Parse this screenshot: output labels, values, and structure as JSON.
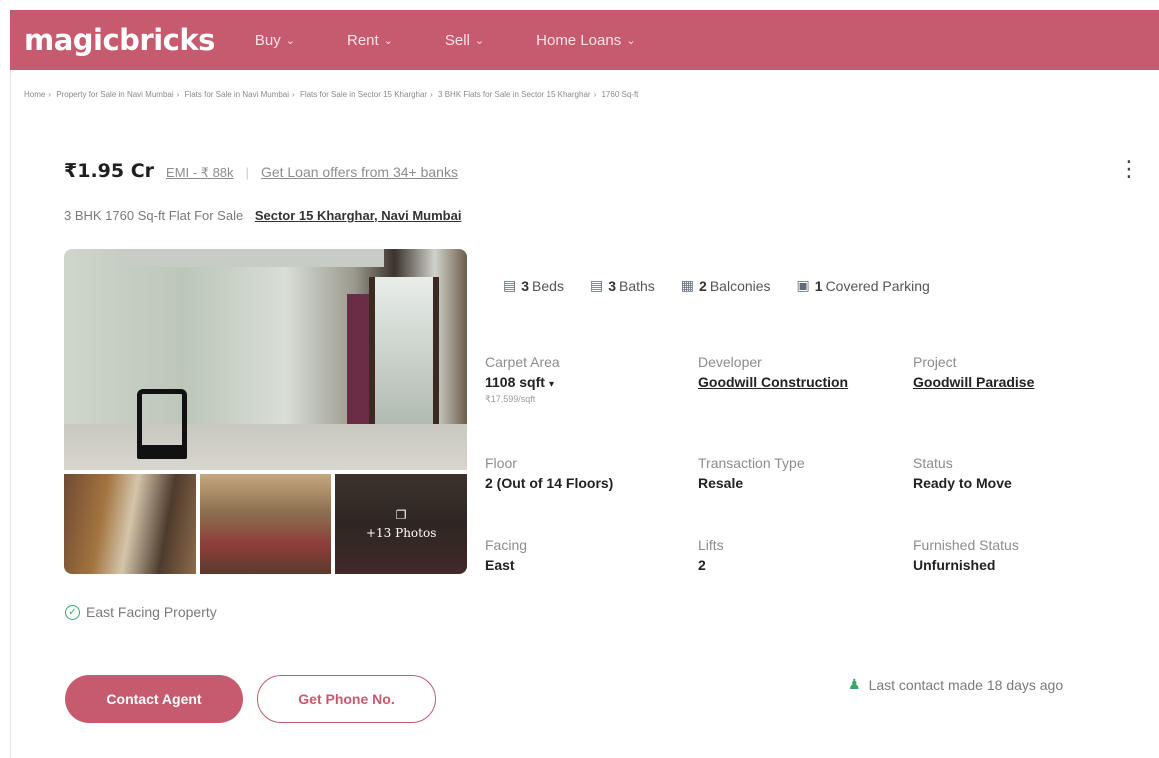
{
  "header": {
    "logo": "magicbricks",
    "nav": [
      {
        "label": "Buy"
      },
      {
        "label": "Rent"
      },
      {
        "label": "Sell"
      },
      {
        "label": "Home Loans"
      }
    ]
  },
  "breadcrumb": [
    "Home",
    "Property for Sale in Navi Mumbai",
    "Flats for Sale in Navi Mumbai",
    "Flats for Sale in Sector 15 Kharghar",
    "3 BHK Flats for Sale in Sector 15 Kharghar",
    "1760 Sq-ft"
  ],
  "listing": {
    "price": "₹1.95 Cr",
    "emi": "EMI - ₹ 88k",
    "loan_offer": "Get Loan offers from 34+ banks",
    "title": "3 BHK 1760 Sq-ft Flat For Sale",
    "location": "Sector 15 Kharghar, Navi Mumbai",
    "more_photos": "+13 Photos"
  },
  "amenities": [
    {
      "icon": "bed-icon",
      "count": "3",
      "label": "Beds"
    },
    {
      "icon": "bath-icon",
      "count": "3",
      "label": "Baths"
    },
    {
      "icon": "balcony-icon",
      "count": "2",
      "label": "Balconies"
    },
    {
      "icon": "car-icon",
      "count": "1",
      "label": "Covered Parking"
    }
  ],
  "specs": {
    "carpet_area": {
      "label": "Carpet Area",
      "value": "1108 sqft",
      "sub": "₹17,599/sqft"
    },
    "developer": {
      "label": "Developer",
      "value": "Goodwill Construction"
    },
    "project": {
      "label": "Project",
      "value": "Goodwill Paradise"
    },
    "floor": {
      "label": "Floor",
      "value": "2 (Out of 14 Floors)"
    },
    "transaction": {
      "label": "Transaction Type",
      "value": "Resale"
    },
    "status": {
      "label": "Status",
      "value": "Ready to Move"
    },
    "facing": {
      "label": "Facing",
      "value": "East"
    },
    "lifts": {
      "label": "Lifts",
      "value": "2"
    },
    "furnished": {
      "label": "Furnished Status",
      "value": "Unfurnished"
    }
  },
  "highlight": "East Facing Property",
  "actions": {
    "contact_agent": "Contact Agent",
    "phone": "Get Phone No."
  },
  "last_contact": "Last contact made 18 days ago",
  "colors": {
    "brand": "#c65a6e",
    "success": "#3aa66b"
  }
}
